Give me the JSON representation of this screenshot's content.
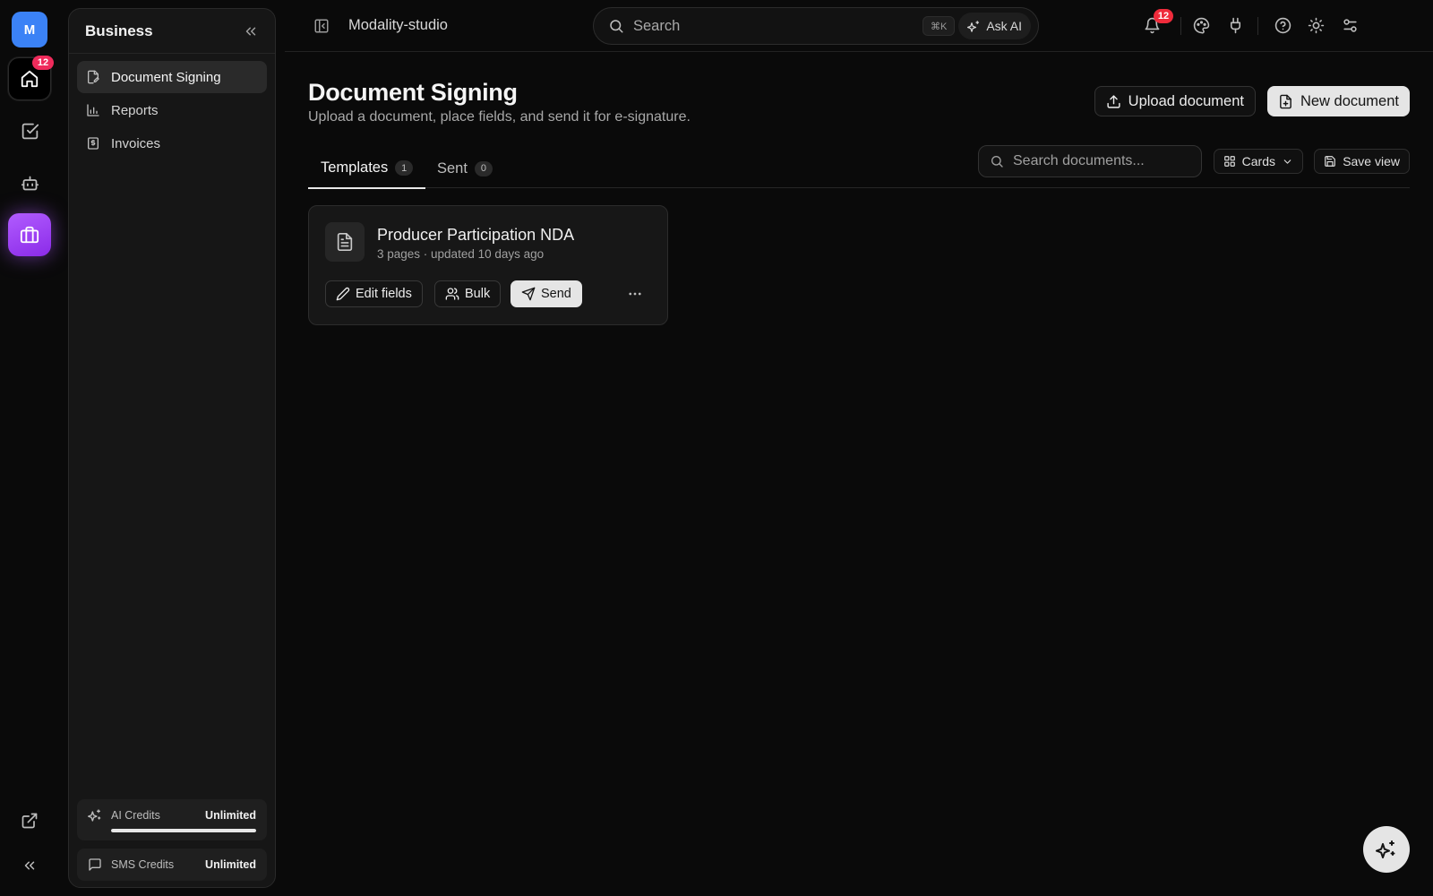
{
  "rail": {
    "avatar_initial": "M",
    "home_badge": "12"
  },
  "sidebar": {
    "title": "Business",
    "items": [
      {
        "label": "Document Signing",
        "icon": "file-signature-icon",
        "active": true
      },
      {
        "label": "Reports",
        "icon": "bar-chart-icon",
        "active": false
      },
      {
        "label": "Invoices",
        "icon": "invoice-icon",
        "active": false
      }
    ],
    "credits": {
      "ai_label": "AI Credits",
      "ai_value": "Unlimited",
      "ai_level": 1.0,
      "sms_label": "SMS Credits",
      "sms_value": "Unlimited"
    }
  },
  "topbar": {
    "workspace": "Modality-studio",
    "search_placeholder": "Search",
    "shortcut": "⌘K",
    "ask_ai_label": "Ask AI",
    "notifications_badge": "12"
  },
  "page": {
    "title": "Document Signing",
    "subtitle": "Upload a document, place fields, and send it for e-signature.",
    "upload_label": "Upload document",
    "new_label": "New document",
    "tabs": [
      {
        "label": "Templates",
        "count": "1",
        "active": true
      },
      {
        "label": "Sent",
        "count": "0",
        "active": false
      }
    ],
    "doc_search_placeholder": "Search documents...",
    "view_label": "Cards",
    "save_view_label": "Save view"
  },
  "cards": [
    {
      "title": "Producer Participation NDA",
      "meta": "3 pages · updated 10 days ago",
      "edit_label": "Edit fields",
      "bulk_label": "Bulk",
      "send_label": "Send"
    }
  ],
  "colors": {
    "background": "#0a0a0a",
    "panel": "#161616",
    "accent_business": "#a855f7",
    "avatar": "#3b82f6",
    "badge": "#ef2b5b"
  }
}
